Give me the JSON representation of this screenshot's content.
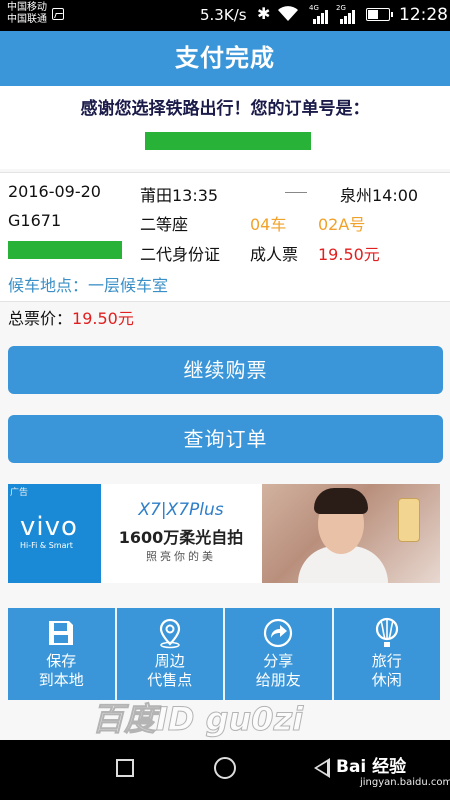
{
  "status_bar": {
    "carrier1": "中国移动",
    "carrier2": "中国联通",
    "net_speed": "5.3K/s",
    "sig1_type": "4G",
    "sig2_type": "2G",
    "battery_level": 0.55,
    "time": "12:28"
  },
  "header": {
    "title": "支付完成"
  },
  "thanks": {
    "message": "感谢您选择铁路出行！您的订单号是：",
    "order_number_masked": "----------------"
  },
  "ticket": {
    "date": "2016-09-20",
    "departure": "莆田13:35",
    "arrival": "泉州14:00",
    "train": "G1671",
    "seat_class": "二等座",
    "car": "04车",
    "seat": "02A号",
    "id_type": "二代身份证",
    "ticket_type": "成人票",
    "price": "19.50元",
    "waiting_location": "候车地点：一层候车室"
  },
  "total": {
    "label": "总票价：",
    "value": "19.50元"
  },
  "buttons": {
    "continue": "继续购票",
    "query": "查询订单"
  },
  "ad": {
    "tag": "广告",
    "brand": "vivo",
    "brand_sub": "Hi-Fi & Smart",
    "model": "X7|X7Plus",
    "slogan": "1600万柔光自拍",
    "tagline": "照亮你的美"
  },
  "grid": [
    {
      "line1": "保存",
      "line2": "到本地",
      "icon": "save-icon"
    },
    {
      "line1": "周边",
      "line2": "代售点",
      "icon": "location-icon"
    },
    {
      "line1": "分享",
      "line2": "给朋友",
      "icon": "share-icon"
    },
    {
      "line1": "旅行",
      "line2": "休闲",
      "icon": "balloon-icon"
    }
  ],
  "watermark": {
    "text": "百度ID gu0zi",
    "brand": "Bai 经验",
    "url": "jingyan.baidu.com"
  },
  "colors": {
    "primary": "#3a96d8",
    "green_mask": "#28b238",
    "orange": "#f0a22a",
    "red": "#e02020",
    "link": "#3a8fc6"
  }
}
